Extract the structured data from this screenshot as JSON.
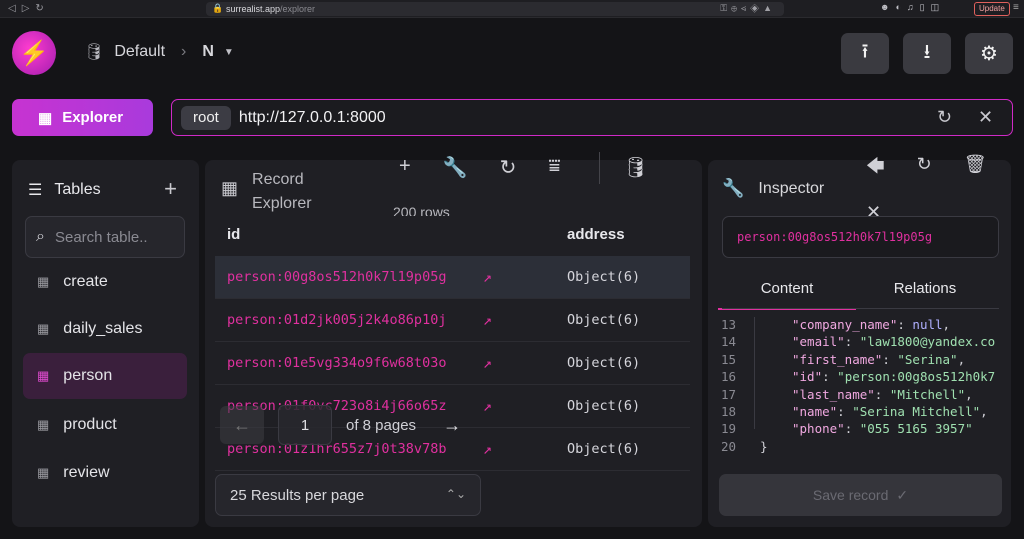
{
  "browser": {
    "url_host": "surrealist.app",
    "url_path": "/explorer",
    "update_label": "Update"
  },
  "header": {
    "namespace_db_label": "Default",
    "database": "N"
  },
  "connection": {
    "user": "root",
    "endpoint": "http://127.0.0.1:8000"
  },
  "nav": {
    "explorer_label": "Explorer"
  },
  "tables": {
    "title": "Tables",
    "search_placeholder": "Search table..",
    "items": [
      {
        "label": "create"
      },
      {
        "label": "daily_sales"
      },
      {
        "label": "person",
        "active": true
      },
      {
        "label": "product"
      },
      {
        "label": "review"
      }
    ]
  },
  "records": {
    "title_line1": "Record",
    "title_line2": "Explorer",
    "row_count": "200 rows",
    "columns": [
      "id",
      "address"
    ],
    "rows": [
      {
        "id": "person:00g8os512h0k7l19p05g",
        "address": "Object(6)",
        "selected": true
      },
      {
        "id": "person:01d2jk005j2k4o86p10j",
        "address": "Object(6)"
      },
      {
        "id": "person:01e5vg334o9f6w68t03o",
        "address": "Object(6)"
      },
      {
        "id": "person:01f0vc723o8i4j66o65z",
        "address": "Object(6)"
      },
      {
        "id": "person:01z1hr655z7j0t38v78b",
        "address": "Object(6)"
      }
    ],
    "pagination": {
      "current_page": "1",
      "of_pages": "of 8 pages"
    },
    "per_page": "25 Results per page"
  },
  "inspector": {
    "title": "Inspector",
    "record_id": "person:00g8os512h0k7l19p05g",
    "tabs": [
      "Content",
      "Relations"
    ],
    "active_tab": "Content",
    "lines": [
      {
        "n": "13",
        "key": "\"company_name\"",
        "val": "null",
        "type": "n",
        "comma": ","
      },
      {
        "n": "14",
        "key": "\"email\"",
        "val": "\"law1800@yandex.co",
        "type": "s",
        "comma": ""
      },
      {
        "n": "15",
        "key": "\"first_name\"",
        "val": "\"Serina\"",
        "type": "s",
        "comma": ","
      },
      {
        "n": "16",
        "key": "\"id\"",
        "val": "\"person:00g8os512h0k7",
        "type": "s",
        "comma": ""
      },
      {
        "n": "17",
        "key": "\"last_name\"",
        "val": "\"Mitchell\"",
        "type": "s",
        "comma": ","
      },
      {
        "n": "18",
        "key": "\"name\"",
        "val": "\"Serina Mitchell\"",
        "type": "s",
        "comma": ","
      },
      {
        "n": "19",
        "key": "\"phone\"",
        "val": "\"055 5165 3957\"",
        "type": "s",
        "comma": ""
      },
      {
        "n": "20",
        "key": "",
        "val": "}",
        "type": "p",
        "comma": ""
      }
    ],
    "save_label": "Save record"
  }
}
